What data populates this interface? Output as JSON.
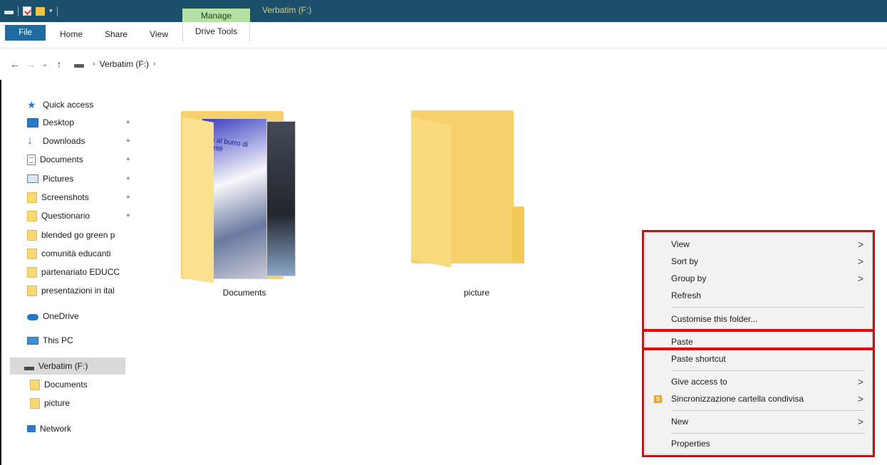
{
  "titlebar": {
    "manage_tab": "Manage",
    "window_title": "Verbatim (F:)"
  },
  "ribbon": {
    "tabs": [
      {
        "label": "File"
      },
      {
        "label": "Home"
      },
      {
        "label": "Share"
      },
      {
        "label": "View"
      },
      {
        "label": "Drive Tools"
      }
    ]
  },
  "address": {
    "back": "←",
    "forward": "→",
    "recent": "⌄",
    "up": "↑",
    "separator": "›",
    "path": [
      "Verbatim (F:)"
    ]
  },
  "sidebar": {
    "quick_access": "Quick access",
    "items": [
      {
        "label": "Desktop",
        "icon": "desktop-icon",
        "pinned": true
      },
      {
        "label": "Downloads",
        "icon": "download-icon",
        "pinned": true
      },
      {
        "label": "Documents",
        "icon": "document-icon",
        "pinned": true
      },
      {
        "label": "Pictures",
        "icon": "pictures-icon",
        "pinned": true
      },
      {
        "label": "Screenshots",
        "icon": "folder-icon",
        "pinned": true
      },
      {
        "label": "Questionario",
        "icon": "folder-icon",
        "pinned": true
      },
      {
        "label": "blended go green p",
        "icon": "folder-icon",
        "pinned": false
      },
      {
        "label": "comunità educanti",
        "icon": "folder-icon",
        "pinned": false
      },
      {
        "label": "partenariato EDUCC",
        "icon": "folder-icon",
        "pinned": false
      },
      {
        "label": "presentazioni in ital",
        "icon": "folder-icon",
        "pinned": false
      }
    ],
    "onedrive": "OneDrive",
    "this_pc": "This PC",
    "drive": "Verbatim (F:)",
    "drive_children": [
      "Documents",
      "picture"
    ],
    "network": "Network"
  },
  "content": {
    "folders": [
      {
        "label": "Documents"
      },
      {
        "label": "picture"
      }
    ],
    "thumb_title": "tte al burro di karitè"
  },
  "context_menu": {
    "items": [
      {
        "label": "View",
        "submenu": true
      },
      {
        "label": "Sort by",
        "submenu": true
      },
      {
        "label": "Group by",
        "submenu": true
      },
      {
        "label": "Refresh",
        "submenu": false
      },
      {
        "label": "Customise this folder...",
        "submenu": false
      },
      {
        "label": "Paste",
        "submenu": false
      },
      {
        "label": "Paste shortcut",
        "submenu": false
      },
      {
        "label": "Give access to",
        "submenu": true
      },
      {
        "label": "Sincronizzazione cartella condivisa",
        "submenu": true
      },
      {
        "label": "New",
        "submenu": true
      },
      {
        "label": "Properties",
        "submenu": false
      }
    ],
    "submenu_arrow": ">",
    "sync_icon_letter": "S",
    "highlight_color": "#e8000b"
  },
  "colors": {
    "titlebar": "#1b4f6b",
    "manage_tab": "#b4e2a4",
    "file_tab": "#1c6ca1",
    "folder": "#f6d06a"
  }
}
